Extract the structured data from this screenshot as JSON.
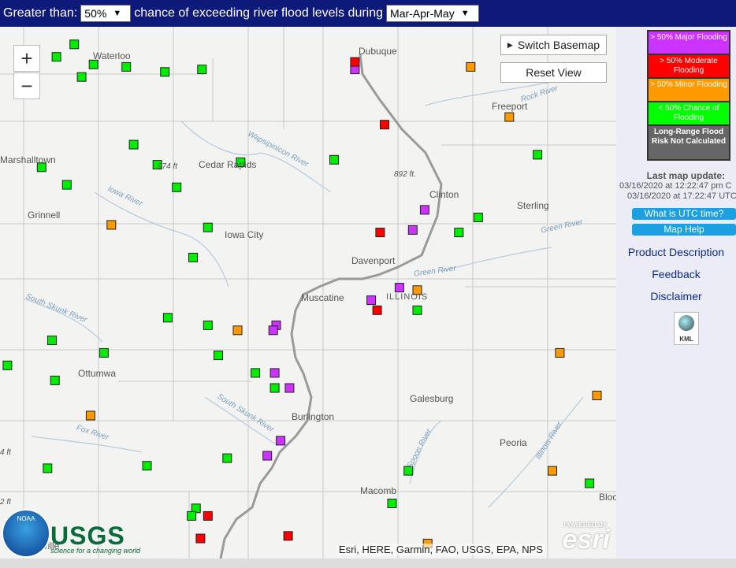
{
  "topbar": {
    "prefix": "Greater than:",
    "threshold": "50%",
    "middle": "chance of exceeding river flood levels during",
    "period": "Mar-Apr-May"
  },
  "map": {
    "switch_basemap": "Switch Basemap",
    "reset_view": "Reset View",
    "zoom_in": "+",
    "zoom_out": "−",
    "attribution": "Esri, HERE, Garmin, FAO, USGS, EPA, NPS",
    "powered_by": "POWERED BY",
    "esri": "esri",
    "noaa": "NOAA",
    "usgs": "USGS",
    "usgs_tagline": "science for a changing world",
    "places": [
      {
        "id": "waterloo",
        "text": "Waterloo"
      },
      {
        "id": "dubuque",
        "text": "Dubuque"
      },
      {
        "id": "freeport",
        "text": "Freeport"
      },
      {
        "id": "marshalltown",
        "text": "Marshalltown"
      },
      {
        "id": "cedar-rapids",
        "text": "Cedar Rapids"
      },
      {
        "id": "elev-974",
        "text": "974 ft"
      },
      {
        "id": "elev-892",
        "text": "892 ft."
      },
      {
        "id": "clinton",
        "text": "Clinton"
      },
      {
        "id": "sterling",
        "text": "Sterling"
      },
      {
        "id": "grinnell",
        "text": "Grinnell"
      },
      {
        "id": "iowa-city",
        "text": "Iowa City"
      },
      {
        "id": "davenport",
        "text": "Davenport"
      },
      {
        "id": "muscatine",
        "text": "Muscatine"
      },
      {
        "id": "illinois",
        "text": "ILLINOIS"
      },
      {
        "id": "ottumwa",
        "text": "Ottumwa"
      },
      {
        "id": "galesburg",
        "text": "Galesburg"
      },
      {
        "id": "burlington",
        "text": "Burlington"
      },
      {
        "id": "peoria",
        "text": "Peoria"
      },
      {
        "id": "macomb",
        "text": "Macomb"
      },
      {
        "id": "bloom",
        "text": "Bloo"
      },
      {
        "id": "elev-4",
        "text": "4 ft"
      },
      {
        "id": "elev-2",
        "text": "2 ft"
      },
      {
        "id": "kesville",
        "text": "kesville"
      }
    ],
    "rivers": [
      {
        "id": "wapsipinicon",
        "text": "Wapsipinicon River"
      },
      {
        "id": "iowa-river",
        "text": "Iowa River"
      },
      {
        "id": "rock-river",
        "text": "Rock River"
      },
      {
        "id": "green-river",
        "text": "Green River"
      },
      {
        "id": "green-river-2",
        "text": "Green River"
      },
      {
        "id": "south-skunk",
        "text": "South Skunk River"
      },
      {
        "id": "south-skunk-2",
        "text": "South Skunk River"
      },
      {
        "id": "fox-river",
        "text": "Fox River"
      },
      {
        "id": "spoon-river",
        "text": "Spoon River"
      },
      {
        "id": "illinois-river",
        "text": "Illinois River"
      }
    ],
    "gauges": [
      {
        "cat": "green",
        "lon": -92.55,
        "lat": 42.93
      },
      {
        "cat": "green",
        "lon": -92.67,
        "lat": 42.88
      },
      {
        "cat": "green",
        "lon": -92.42,
        "lat": 42.85
      },
      {
        "cat": "green",
        "lon": -92.2,
        "lat": 42.84
      },
      {
        "cat": "green",
        "lon": -92.5,
        "lat": 42.8
      },
      {
        "cat": "green",
        "lon": -91.94,
        "lat": 42.82
      },
      {
        "cat": "green",
        "lon": -91.69,
        "lat": 42.83
      },
      {
        "cat": "purple",
        "lon": -90.66,
        "lat": 42.83
      },
      {
        "cat": "red",
        "lon": -90.66,
        "lat": 42.86
      },
      {
        "cat": "orange",
        "lon": -89.6,
        "lat": 42.94
      },
      {
        "cat": "orange",
        "lon": -89.88,
        "lat": 42.84
      },
      {
        "cat": "red",
        "lon": -90.46,
        "lat": 42.61
      },
      {
        "cat": "orange",
        "lon": -89.62,
        "lat": 42.64
      },
      {
        "cat": "green",
        "lon": -92.15,
        "lat": 42.53
      },
      {
        "cat": "green",
        "lon": -92.77,
        "lat": 42.44
      },
      {
        "cat": "green",
        "lon": -91.99,
        "lat": 42.45
      },
      {
        "cat": "green",
        "lon": -91.43,
        "lat": 42.46
      },
      {
        "cat": "green",
        "lon": -90.8,
        "lat": 42.47
      },
      {
        "cat": "green",
        "lon": -89.43,
        "lat": 42.49
      },
      {
        "cat": "green",
        "lon": -92.6,
        "lat": 42.37
      },
      {
        "cat": "green",
        "lon": -91.86,
        "lat": 42.36
      },
      {
        "cat": "purple",
        "lon": -90.19,
        "lat": 42.27
      },
      {
        "cat": "purple",
        "lon": -90.27,
        "lat": 42.19
      },
      {
        "cat": "red",
        "lon": -90.49,
        "lat": 42.18
      },
      {
        "cat": "orange",
        "lon": -92.3,
        "lat": 42.21
      },
      {
        "cat": "green",
        "lon": -91.65,
        "lat": 42.2
      },
      {
        "cat": "green",
        "lon": -89.83,
        "lat": 42.24
      },
      {
        "cat": "green",
        "lon": -89.96,
        "lat": 42.18
      },
      {
        "cat": "green",
        "lon": -91.75,
        "lat": 42.08
      },
      {
        "cat": "purple",
        "lon": -90.36,
        "lat": 41.96
      },
      {
        "cat": "purple",
        "lon": -90.55,
        "lat": 41.91
      },
      {
        "cat": "red",
        "lon": -90.51,
        "lat": 41.87
      },
      {
        "cat": "orange",
        "lon": -90.24,
        "lat": 41.95
      },
      {
        "cat": "green",
        "lon": -90.24,
        "lat": 41.87
      },
      {
        "cat": "green",
        "lon": -91.92,
        "lat": 41.84
      },
      {
        "cat": "green",
        "lon": -91.65,
        "lat": 41.81
      },
      {
        "cat": "purple",
        "lon": -91.19,
        "lat": 41.81
      },
      {
        "cat": "purple",
        "lon": -91.21,
        "lat": 41.79
      },
      {
        "cat": "orange",
        "lon": -91.45,
        "lat": 41.79
      },
      {
        "cat": "green",
        "lon": -92.7,
        "lat": 41.75
      },
      {
        "cat": "green",
        "lon": -92.35,
        "lat": 41.7
      },
      {
        "cat": "green",
        "lon": -91.58,
        "lat": 41.69
      },
      {
        "cat": "green",
        "lon": -93.0,
        "lat": 41.65
      },
      {
        "cat": "purple",
        "lon": -91.2,
        "lat": 41.62
      },
      {
        "cat": "green",
        "lon": -91.33,
        "lat": 41.62
      },
      {
        "cat": "green",
        "lon": -92.68,
        "lat": 41.59
      },
      {
        "cat": "green",
        "lon": -91.2,
        "lat": 41.56
      },
      {
        "cat": "purple",
        "lon": -91.1,
        "lat": 41.56
      },
      {
        "cat": "orange",
        "lon": -92.44,
        "lat": 41.45
      },
      {
        "cat": "orange",
        "lon": -89.03,
        "lat": 41.53
      },
      {
        "cat": "orange",
        "lon": -89.28,
        "lat": 41.7
      },
      {
        "cat": "purple",
        "lon": -91.16,
        "lat": 41.35
      },
      {
        "cat": "purple",
        "lon": -91.25,
        "lat": 41.29
      },
      {
        "cat": "green",
        "lon": -91.52,
        "lat": 41.28
      },
      {
        "cat": "green",
        "lon": -92.06,
        "lat": 41.25
      },
      {
        "cat": "green",
        "lon": -92.73,
        "lat": 41.24
      },
      {
        "cat": "green",
        "lon": -90.3,
        "lat": 41.23
      },
      {
        "cat": "orange",
        "lon": -89.33,
        "lat": 41.23
      },
      {
        "cat": "green",
        "lon": -89.08,
        "lat": 41.18
      },
      {
        "cat": "green",
        "lon": -90.41,
        "lat": 41.1
      },
      {
        "cat": "green",
        "lon": -91.73,
        "lat": 41.08
      },
      {
        "cat": "green",
        "lon": -91.76,
        "lat": 41.05
      },
      {
        "cat": "red",
        "lon": -91.65,
        "lat": 41.05
      },
      {
        "cat": "red",
        "lon": -91.11,
        "lat": 40.97
      },
      {
        "cat": "red",
        "lon": -91.7,
        "lat": 40.96
      },
      {
        "cat": "orange",
        "lon": -90.17,
        "lat": 40.94
      }
    ]
  },
  "legend": [
    {
      "id": "major",
      "text": "> 50% Major Flooding",
      "bg": "#cc33ff",
      "fg": "#ffffff"
    },
    {
      "id": "moderate",
      "text": "> 50% Moderate Flooding",
      "bg": "#ff0000",
      "fg": "#ffffff"
    },
    {
      "id": "minor",
      "text": "> 50% Minor Flooding",
      "bg": "#ff9900",
      "fg": "#ffffff"
    },
    {
      "id": "less",
      "text": "< 50% Chance of Flooding",
      "bg": "#00ff00",
      "fg": "#ffffff"
    },
    {
      "id": "notcalc",
      "text": "Long-Range Flood Risk Not Calculated",
      "bg": "#666666",
      "fg": "#ffffff"
    }
  ],
  "colors": {
    "purple": "#cc33ff",
    "red": "#ff0000",
    "orange": "#ff9900",
    "green": "#00ee00"
  },
  "sidebar": {
    "updated_heading": "Last map update:",
    "updated_local": "03/16/2020 at 12:22:47 pm C",
    "updated_utc": "03/16/2020 at 17:22:47 UTC",
    "utc_button": "What is UTC time?",
    "help_button": "Map Help",
    "product_description": "Product Description",
    "feedback": "Feedback",
    "disclaimer": "Disclaimer",
    "kml": "KML"
  }
}
